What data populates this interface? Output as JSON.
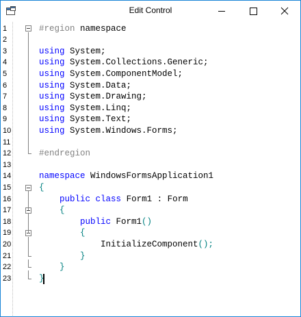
{
  "window": {
    "title": "Edit Control"
  },
  "lines": [
    {
      "n": "1",
      "fold": "open",
      "tokens": [
        {
          "t": "#region",
          "c": "pp"
        },
        {
          "t": " namespace",
          "c": "id"
        }
      ]
    },
    {
      "n": "2",
      "fold": "guide",
      "tokens": []
    },
    {
      "n": "3",
      "fold": "guide",
      "tokens": [
        {
          "t": "using",
          "c": "kw"
        },
        {
          "t": " System;",
          "c": "id"
        }
      ]
    },
    {
      "n": "4",
      "fold": "guide",
      "tokens": [
        {
          "t": "using",
          "c": "kw"
        },
        {
          "t": " System.Collections.Generic;",
          "c": "id"
        }
      ]
    },
    {
      "n": "5",
      "fold": "guide",
      "tokens": [
        {
          "t": "using",
          "c": "kw"
        },
        {
          "t": " System.ComponentModel;",
          "c": "id"
        }
      ]
    },
    {
      "n": "6",
      "fold": "guide",
      "tokens": [
        {
          "t": "using",
          "c": "kw"
        },
        {
          "t": " System.Data;",
          "c": "id"
        }
      ]
    },
    {
      "n": "7",
      "fold": "guide",
      "tokens": [
        {
          "t": "using",
          "c": "kw"
        },
        {
          "t": " System.Drawing;",
          "c": "id"
        }
      ]
    },
    {
      "n": "8",
      "fold": "guide",
      "tokens": [
        {
          "t": "using",
          "c": "kw"
        },
        {
          "t": " System.Linq;",
          "c": "id"
        }
      ]
    },
    {
      "n": "9",
      "fold": "guide",
      "tokens": [
        {
          "t": "using",
          "c": "kw"
        },
        {
          "t": " System.Text;",
          "c": "id"
        }
      ]
    },
    {
      "n": "10",
      "fold": "guide",
      "tokens": [
        {
          "t": "using",
          "c": "kw"
        },
        {
          "t": " System.Windows.Forms;",
          "c": "id"
        }
      ]
    },
    {
      "n": "11",
      "fold": "guide",
      "tokens": []
    },
    {
      "n": "12",
      "fold": "end",
      "tokens": [
        {
          "t": "#endregion",
          "c": "pp"
        }
      ]
    },
    {
      "n": "13",
      "fold": "none",
      "tokens": []
    },
    {
      "n": "14",
      "fold": "none",
      "tokens": [
        {
          "t": "namespace",
          "c": "kw"
        },
        {
          "t": " WindowsFormsApplication1",
          "c": "id"
        }
      ]
    },
    {
      "n": "15",
      "fold": "open",
      "tokens": [
        {
          "t": "{",
          "c": "pn"
        }
      ]
    },
    {
      "n": "16",
      "fold": "guide",
      "tokens": [
        {
          "t": "    ",
          "c": "id"
        },
        {
          "t": "public",
          "c": "kw"
        },
        {
          "t": " ",
          "c": "id"
        },
        {
          "t": "class",
          "c": "kw"
        },
        {
          "t": " Form1 : Form",
          "c": "id"
        }
      ]
    },
    {
      "n": "17",
      "fold": "open",
      "tokens": [
        {
          "t": "    ",
          "c": "id"
        },
        {
          "t": "{",
          "c": "pn"
        }
      ]
    },
    {
      "n": "18",
      "fold": "guide",
      "tokens": [
        {
          "t": "        ",
          "c": "id"
        },
        {
          "t": "public",
          "c": "kw"
        },
        {
          "t": " Form1",
          "c": "id"
        },
        {
          "t": "()",
          "c": "pn"
        }
      ]
    },
    {
      "n": "19",
      "fold": "open",
      "tokens": [
        {
          "t": "        ",
          "c": "id"
        },
        {
          "t": "{",
          "c": "pn"
        }
      ]
    },
    {
      "n": "20",
      "fold": "guide",
      "tokens": [
        {
          "t": "            InitializeComponent",
          "c": "id"
        },
        {
          "t": "();",
          "c": "pn"
        }
      ]
    },
    {
      "n": "21",
      "fold": "end",
      "tokens": [
        {
          "t": "        ",
          "c": "id"
        },
        {
          "t": "}",
          "c": "pn"
        }
      ]
    },
    {
      "n": "22",
      "fold": "end",
      "tokens": [
        {
          "t": "    ",
          "c": "id"
        },
        {
          "t": "}",
          "c": "pn"
        }
      ]
    },
    {
      "n": "23",
      "fold": "end",
      "tokens": [
        {
          "t": "}",
          "c": "pn"
        }
      ]
    }
  ],
  "caret_line": "23",
  "icons": {
    "app": "app-window-icon",
    "minimize": "minimize-icon",
    "maximize": "maximize-icon",
    "close": "close-icon"
  }
}
